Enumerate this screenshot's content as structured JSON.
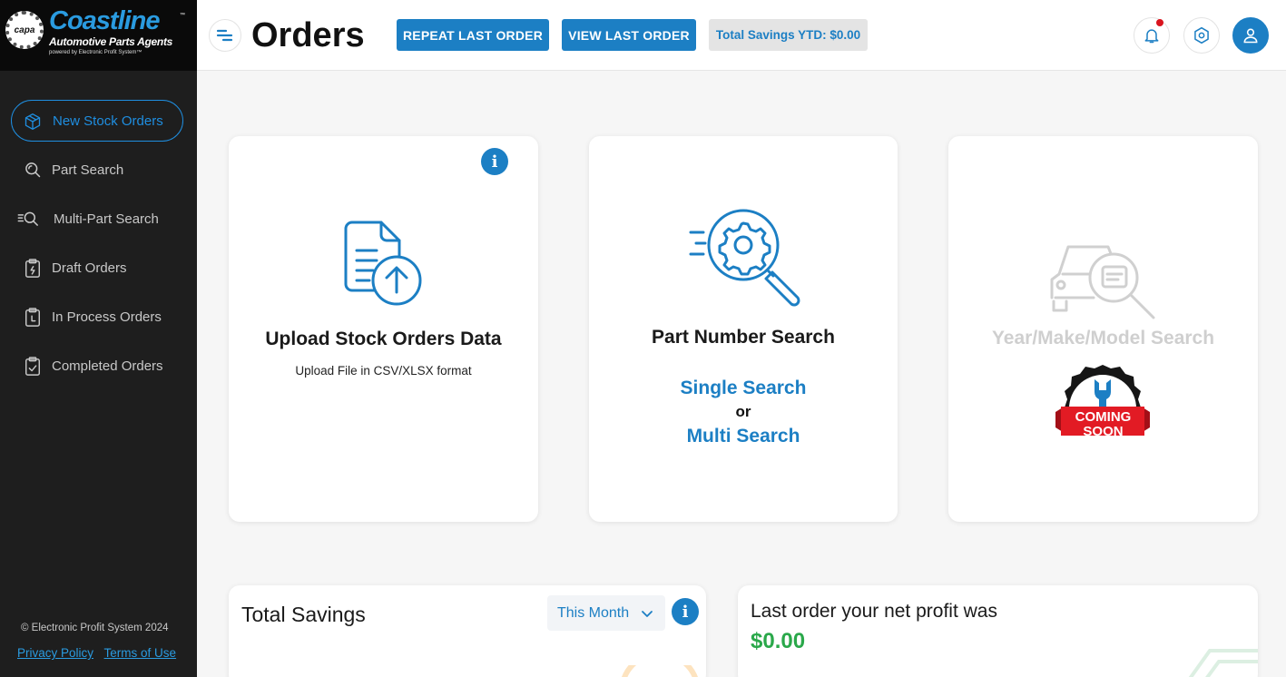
{
  "brand": {
    "badge": "capa",
    "name": "Coastline",
    "tm": "™",
    "tagline": "Automotive Parts Agents",
    "powered": "powered by Electronic Profit System™"
  },
  "sidebar": {
    "items": [
      {
        "label": "New Stock Orders",
        "icon": "cube-icon",
        "active": true
      },
      {
        "label": "Part Search",
        "icon": "search-icon"
      },
      {
        "label": "Multi-Part Search",
        "icon": "multi-search-icon"
      },
      {
        "label": "Draft Orders",
        "icon": "clipboard-draft-icon"
      },
      {
        "label": "In Process Orders",
        "icon": "clipboard-clock-icon"
      },
      {
        "label": "Completed Orders",
        "icon": "clipboard-check-icon"
      }
    ],
    "copyright": "© Electronic Profit System 2024",
    "privacy": "Privacy Policy",
    "terms": "Terms of Use"
  },
  "header": {
    "title": "Orders",
    "repeat_label": "REPEAT LAST ORDER",
    "view_label": "VIEW LAST ORDER",
    "savings_label": "Total Savings YTD: $0.00"
  },
  "cards": {
    "upload": {
      "title": "Upload Stock Orders Data",
      "subtitle": "Upload File in CSV/XLSX format",
      "info": "i"
    },
    "part_number": {
      "title": "Part Number Search",
      "single": "Single Search",
      "or": "or",
      "multi": "Multi Search"
    },
    "ymm": {
      "title": "Year/Make/Model Search",
      "badge_line1": "COMING",
      "badge_line2": "SOON"
    }
  },
  "total_savings": {
    "title": "Total Savings",
    "period": "This Month",
    "info": "i"
  },
  "net_profit": {
    "label": "Last order your net profit was",
    "value": "$0.00"
  },
  "colors": {
    "accent": "#1c7fc4",
    "sidebar_bg": "#1e1e1e",
    "profit_green": "#2aa84a",
    "notify_red": "#d9141e"
  }
}
